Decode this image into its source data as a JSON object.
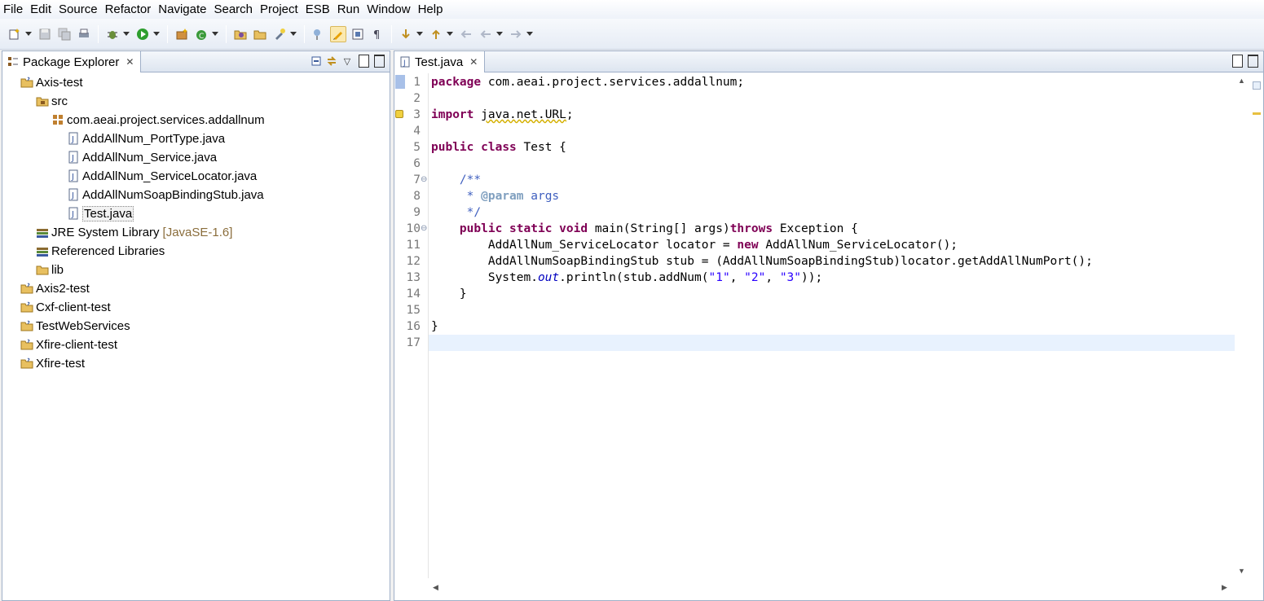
{
  "menu": [
    "File",
    "Edit",
    "Source",
    "Refactor",
    "Navigate",
    "Search",
    "Project",
    "ESB",
    "Run",
    "Window",
    "Help"
  ],
  "package_explorer": {
    "title": "Package Explorer",
    "tree": [
      {
        "label": "Axis-test",
        "icon": "java-project-icon",
        "level": 0
      },
      {
        "label": "src",
        "icon": "source-folder-icon",
        "level": 1
      },
      {
        "label": "com.aeai.project.services.addallnum",
        "icon": "package-icon",
        "level": 2
      },
      {
        "label": "AddAllNum_PortType.java",
        "icon": "java-file-icon",
        "level": 3
      },
      {
        "label": "AddAllNum_Service.java",
        "icon": "java-file-icon",
        "level": 3
      },
      {
        "label": "AddAllNum_ServiceLocator.java",
        "icon": "java-file-icon",
        "level": 3
      },
      {
        "label": "AddAllNumSoapBindingStub.java",
        "icon": "java-file-icon",
        "level": 3
      },
      {
        "label": "Test.java",
        "icon": "java-file-icon",
        "level": 3,
        "selected": true
      },
      {
        "label": "JRE System Library",
        "decoration": "[JavaSE-1.6]",
        "icon": "library-icon",
        "level": 1
      },
      {
        "label": "Referenced Libraries",
        "icon": "library-icon",
        "level": 1
      },
      {
        "label": "lib",
        "icon": "folder-icon",
        "level": 1
      },
      {
        "label": "Axis2-test",
        "icon": "java-project-icon",
        "level": 0
      },
      {
        "label": "Cxf-client-test",
        "icon": "java-project-icon",
        "level": 0
      },
      {
        "label": "TestWebServices",
        "icon": "java-project-icon",
        "level": 0
      },
      {
        "label": "Xfire-client-test",
        "icon": "java-project-icon",
        "level": 0
      },
      {
        "label": "Xfire-test",
        "icon": "java-project-icon",
        "level": 0
      }
    ]
  },
  "editor": {
    "tab_title": "Test.java",
    "current_line": 17,
    "lines": [
      {
        "n": "1",
        "text": "package com.aeai.project.services.addallnum;"
      },
      {
        "n": "2",
        "text": ""
      },
      {
        "n": "3",
        "text": "import java.net.URL;"
      },
      {
        "n": "4",
        "text": ""
      },
      {
        "n": "5",
        "text": "public class Test {"
      },
      {
        "n": "6",
        "text": ""
      },
      {
        "n": "7",
        "text": "    /**"
      },
      {
        "n": "8",
        "text": "     * @param args"
      },
      {
        "n": "9",
        "text": "     */"
      },
      {
        "n": "10",
        "text": "    public static void main(String[] args)throws Exception {"
      },
      {
        "n": "11",
        "text": "        AddAllNum_ServiceLocator locator = new AddAllNum_ServiceLocator();"
      },
      {
        "n": "12",
        "text": "        AddAllNumSoapBindingStub stub = (AddAllNumSoapBindingStub)locator.getAddAllNumPort();"
      },
      {
        "n": "13",
        "text": "        System.out.println(stub.addNum(\"1\", \"2\", \"3\"));"
      },
      {
        "n": "14",
        "text": "    }"
      },
      {
        "n": "15",
        "text": ""
      },
      {
        "n": "16",
        "text": "}"
      },
      {
        "n": "17",
        "text": ""
      }
    ]
  }
}
